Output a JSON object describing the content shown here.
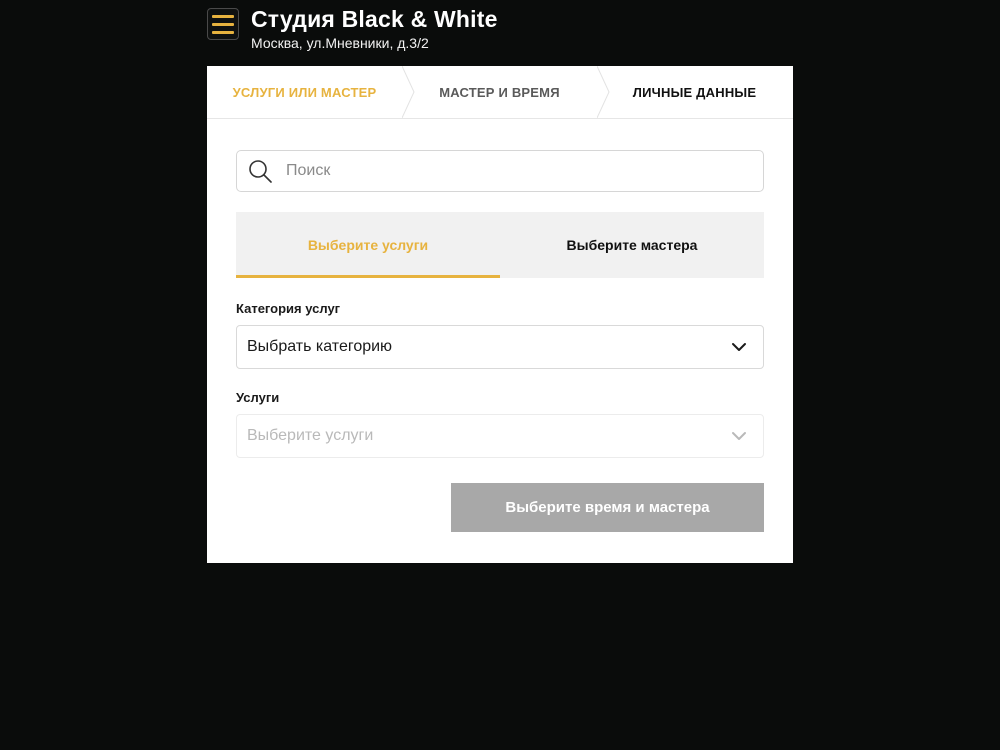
{
  "header": {
    "title": "Студия Black & White",
    "address": "Москва, ул.Мневники, д.3/2"
  },
  "steps": [
    {
      "label": "УСЛУГИ ИЛИ МАСТЕР",
      "state": "active"
    },
    {
      "label": "МАСТЕР И ВРЕМЯ",
      "state": "pending"
    },
    {
      "label": "ЛИЧНЫЕ ДАННЫЕ",
      "state": "pending"
    }
  ],
  "search": {
    "placeholder": "Поиск",
    "value": ""
  },
  "tabs": [
    {
      "label": "Выберите услуги",
      "active": true
    },
    {
      "label": "Выберите мастера",
      "active": false
    }
  ],
  "category": {
    "label": "Категория услуг",
    "value": "Выбрать категорию"
  },
  "services": {
    "label": "Услуги",
    "value": "Выберите услуги",
    "disabled": true
  },
  "submit": {
    "label": "Выберите время и мастера",
    "disabled": true
  },
  "colors": {
    "accent": "#e7b33f",
    "background": "#0a0c0b",
    "disabled_button": "#a8a8a8"
  },
  "icons": [
    "menu-icon",
    "search-icon",
    "chevron-down-icon"
  ]
}
